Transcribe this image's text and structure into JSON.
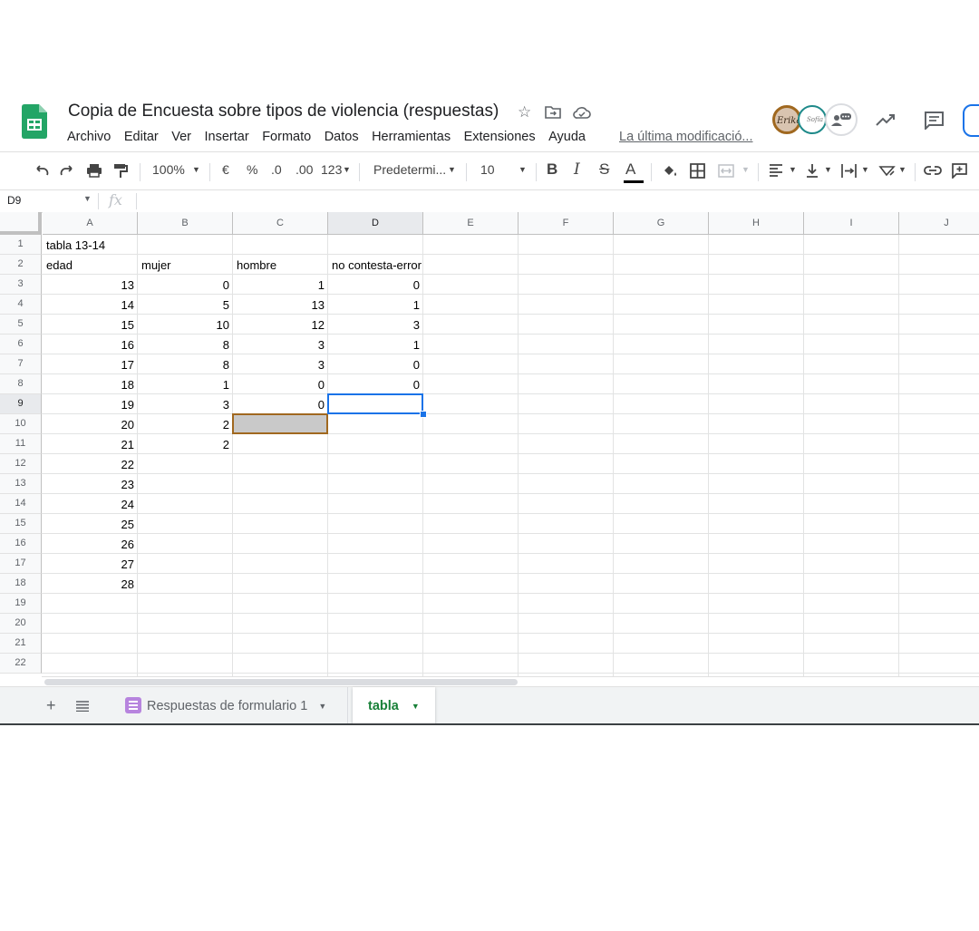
{
  "doc": {
    "title": "Copia de Encuesta sobre tipos de violencia (respuestas)",
    "last_edit": "La última modificació..."
  },
  "menu": [
    "Archivo",
    "Editar",
    "Ver",
    "Insertar",
    "Formato",
    "Datos",
    "Herramientas",
    "Extensiones",
    "Ayuda"
  ],
  "toolbar": {
    "zoom": "100%",
    "currency": "€",
    "percent": "%",
    "decrease_decimals": ".0",
    "increase_decimals": ".00",
    "more_formats": "123",
    "font": "Predetermi...",
    "font_size": "10",
    "bold": "B",
    "italic": "I",
    "strike": "S",
    "text_color": "A"
  },
  "formula_bar": {
    "cell_ref": "D9",
    "fx": "fx",
    "content": ""
  },
  "columns": [
    "A",
    "B",
    "C",
    "D",
    "E",
    "F",
    "G",
    "H",
    "I",
    "J"
  ],
  "rows": [
    "1",
    "2",
    "3",
    "4",
    "5",
    "6",
    "7",
    "8",
    "9",
    "10",
    "11",
    "12",
    "13",
    "14",
    "15",
    "16",
    "17",
    "18",
    "19",
    "20",
    "21",
    "22"
  ],
  "cells": {
    "A1": "tabla 13-14",
    "A2": "edad",
    "B2": "mujer",
    "C2": "hombre",
    "D2": "no contesta-error",
    "A3": "13",
    "B3": "0",
    "C3": "1",
    "D3": "0",
    "A4": "14",
    "B4": "5",
    "C4": "13",
    "D4": "1",
    "A5": "15",
    "B5": "10",
    "C5": "12",
    "D5": "3",
    "A6": "16",
    "B6": "8",
    "C6": "3",
    "D6": "1",
    "A7": "17",
    "B7": "8",
    "C7": "3",
    "D7": "0",
    "A8": "18",
    "B8": "1",
    "C8": "0",
    "D8": "0",
    "A9": "19",
    "B9": "3",
    "C9": "0",
    "A10": "20",
    "B10": "2",
    "A11": "21",
    "B11": "2",
    "A12": "22",
    "A13": "23",
    "A14": "24",
    "A15": "25",
    "A16": "26",
    "A17": "27",
    "A18": "28"
  },
  "selected_cell": "D9",
  "collaborator_cell": "C10",
  "sheets": [
    {
      "label": "Respuestas de formulario 1",
      "active": false
    },
    {
      "label": "tabla",
      "active": true
    }
  ],
  "colors": {
    "accent": "#1a73e8",
    "sheets_green": "#188038",
    "collaborator": "#a0681f"
  },
  "avatars": [
    "Erika",
    "Sofia",
    "anonymous"
  ]
}
